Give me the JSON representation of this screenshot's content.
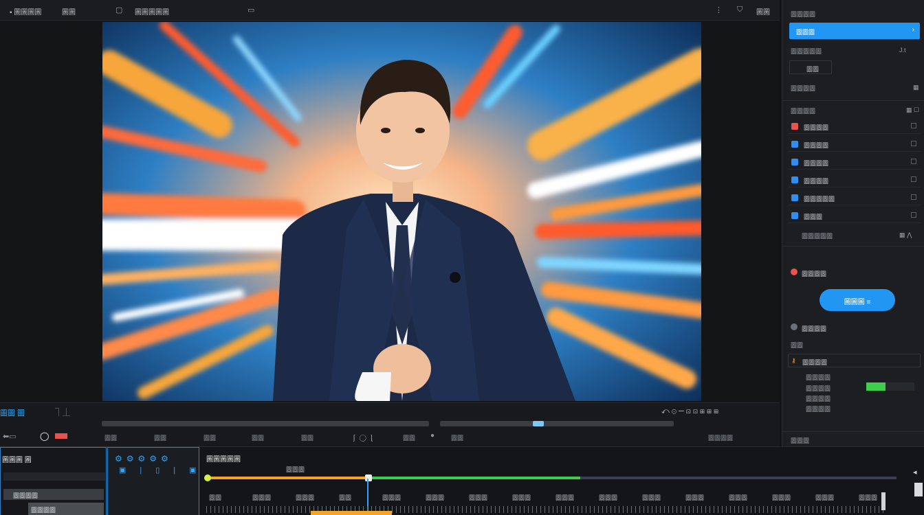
{
  "toolbar": {
    "title": "▪ 圖圖圖圖",
    "menu_1": "圖圖",
    "menu_2": "圖圖圖圖圖",
    "right_label": "圖圖"
  },
  "sidebar": {
    "header": "圖圖圖圖",
    "selected_item": "圖圖圖",
    "field_1": "圖圖圖圖圖",
    "time_label": "J.t",
    "field_2": "圖圖",
    "field_3": "圖圖圖圖",
    "layers_header": "圖圖圖圖",
    "layers": [
      {
        "label": "圖圖圖圖",
        "color": "#e8524f"
      },
      {
        "label": "圖圖圖圖",
        "color": "#2f8ef0"
      },
      {
        "label": "圖圖圖圖",
        "color": "#2f8ef0"
      },
      {
        "label": "圖圖圖圖",
        "color": "#2f8ef0"
      },
      {
        "label": "圖圖圖圖圖",
        "color": "#2f8ef0"
      },
      {
        "label": "圖圖圖",
        "color": "#2f8ef0"
      }
    ],
    "layers_footer": "圖圖圖圖圖",
    "effect_item": "圖圖圖圖",
    "apply_button": "圖圖圖 ≡",
    "audio_item": "圖圖圖圖",
    "audio_label": "圖圖",
    "audio_field": "圖圖圖圖",
    "params": [
      "圖圖圖圖",
      "圖圖圖圖",
      "圖圖圖圖",
      "圖圖圖圖"
    ],
    "footer": "圖圖圖"
  },
  "transport": {
    "mode_label": "圖圖 圖",
    "buttons": [
      "圖圖",
      "圖圖",
      "圖圖",
      "圖圖",
      "圖圖",
      "圖圖",
      "圖圖"
    ],
    "right_label": "圖圖圖圖"
  },
  "timeline": {
    "panel_title": "圖圖圖 圖",
    "clip_1": "圖圖圖圖",
    "clip_2": "圖圖圖圖",
    "track_title": "圖圖圖圖圖",
    "track_sub": "圖圖圖",
    "ruler": [
      "圖圖",
      "圖圖圖",
      "圖圖圖",
      "圖圖",
      "圖圖圖",
      "圖圖圖",
      "圖圖圖",
      "圖圖圖",
      "圖圖圖",
      "圖圖圖",
      "圖圖圖",
      "圖圖圖",
      "圖圖圖",
      "圖圖圖",
      "圖圖圖",
      "圖圖圖"
    ]
  },
  "colors": {
    "accent": "#2196f3",
    "green": "#3ecf4a",
    "orange": "#f5a524",
    "panel": "#1c1e21"
  }
}
